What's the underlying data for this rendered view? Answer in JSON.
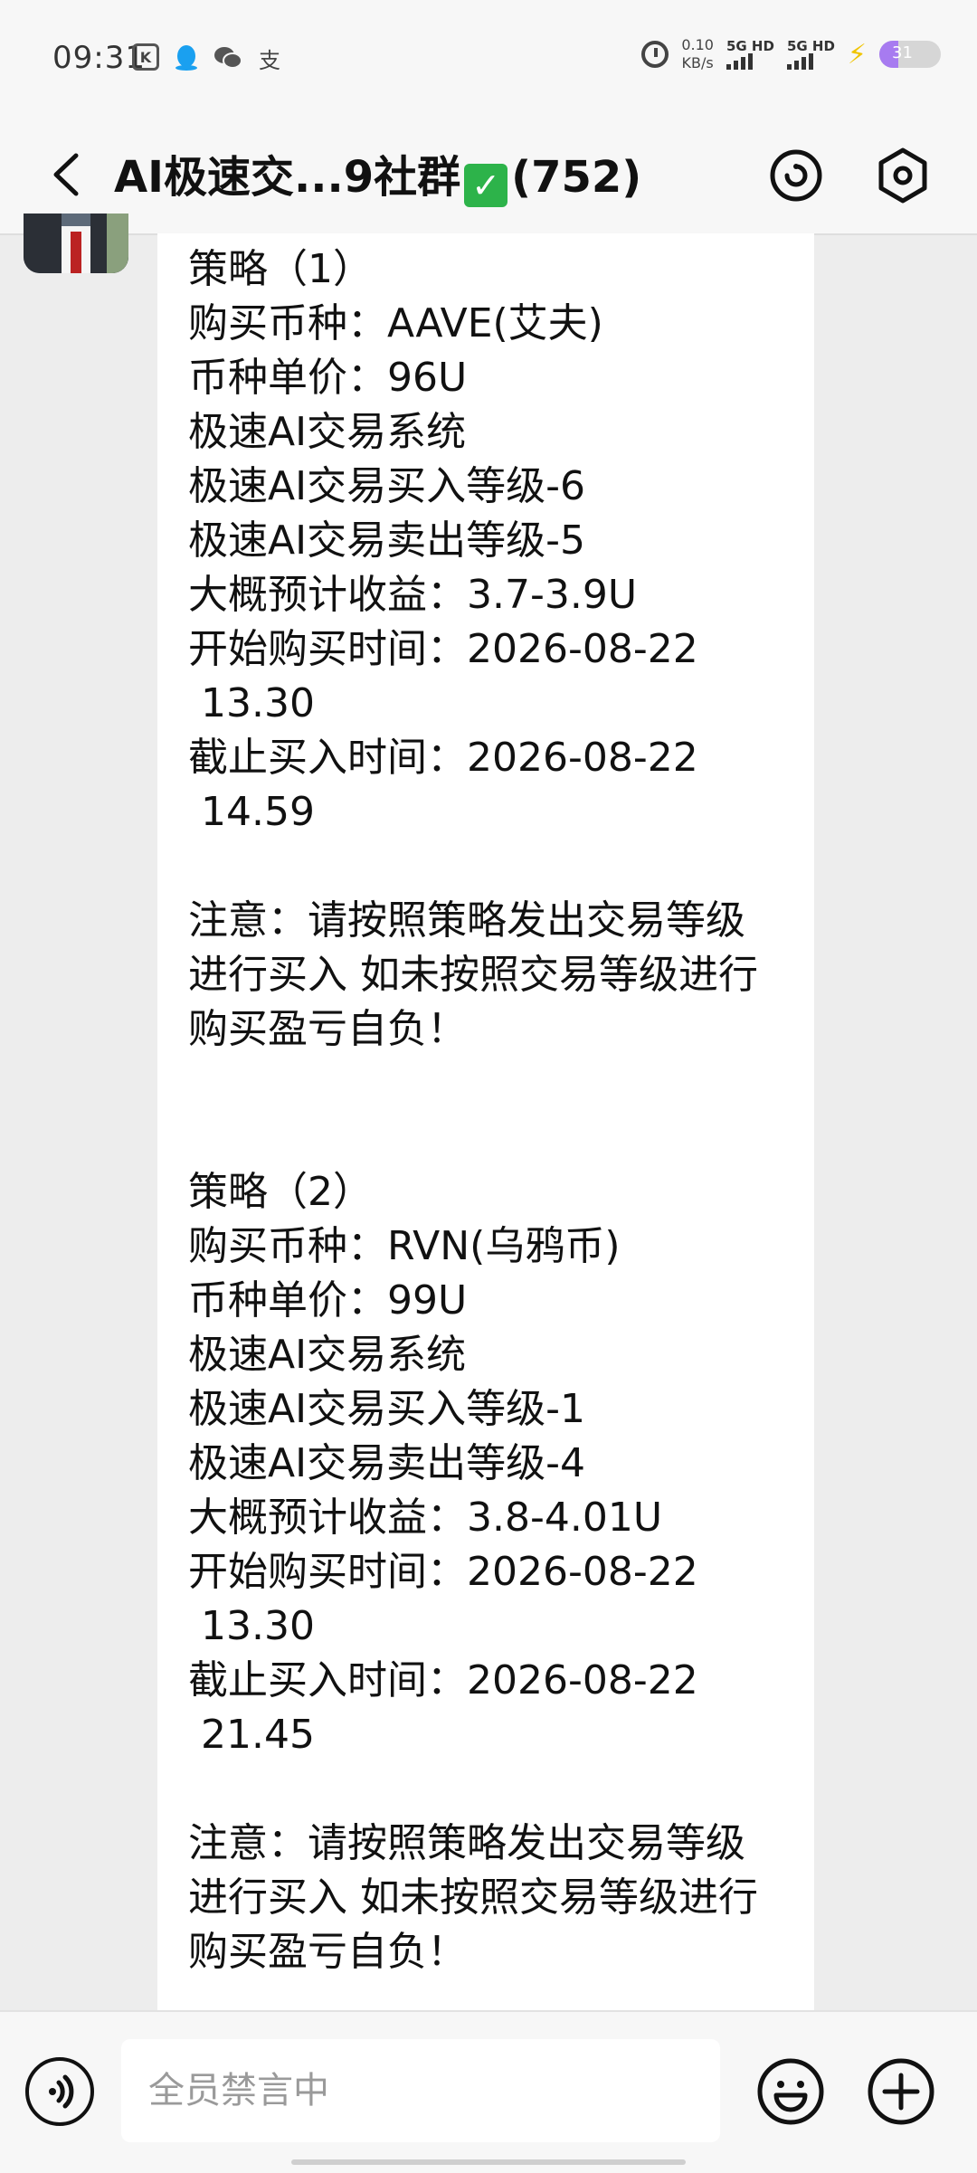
{
  "status_bar": {
    "time": "09:31",
    "left_icons": [
      "k-app-icon",
      "qq-icon",
      "wechat-icon",
      "alipay-icon"
    ],
    "alipay_glyph": "支",
    "speed_value": "0.10",
    "speed_unit": "KB/s",
    "net1": "5G HD",
    "net2": "5G HD",
    "battery": "31",
    "battery_level": 0.31
  },
  "header": {
    "title_prefix": "AI极速交...9社群",
    "check_glyph": "✓",
    "member_count": "(752)"
  },
  "message": {
    "lines": [
      "策略（1）",
      "购买币种：AAVE(艾夫)",
      "币种单价：96U",
      "极速AI交易系统",
      "极速AI交易买入等级-6",
      "极速AI交易卖出等级-5",
      "大概预计收益：3.7-3.9U",
      "开始购买时间：2026-08-22",
      "13.30",
      "截止买入时间：2026-08-22",
      "14.59",
      "",
      "注意：请按照策略发出交易等级",
      "进行买入 如未按照交易等级进行",
      "购买盈亏自负！",
      "",
      "",
      "策略（2）",
      "购买币种：RVN(乌鸦币)",
      "币种单价：99U",
      "极速AI交易系统",
      "极速AI交易买入等级-1",
      "极速AI交易卖出等级-4",
      "大概预计收益：3.8-4.01U",
      "开始购买时间：2026-08-22",
      "13.30",
      "截止买入时间：2026-08-22",
      "21.45",
      "",
      "注意：请按照策略发出交易等级",
      "进行买入 如未按照交易等级进行",
      "购买盈亏自负！"
    ]
  },
  "input_bar": {
    "placeholder": "全员禁言中"
  },
  "colors": {
    "check_green": "#2db34a",
    "battery_purple": "#a77bf0",
    "charge_yellow": "#f0c400"
  }
}
